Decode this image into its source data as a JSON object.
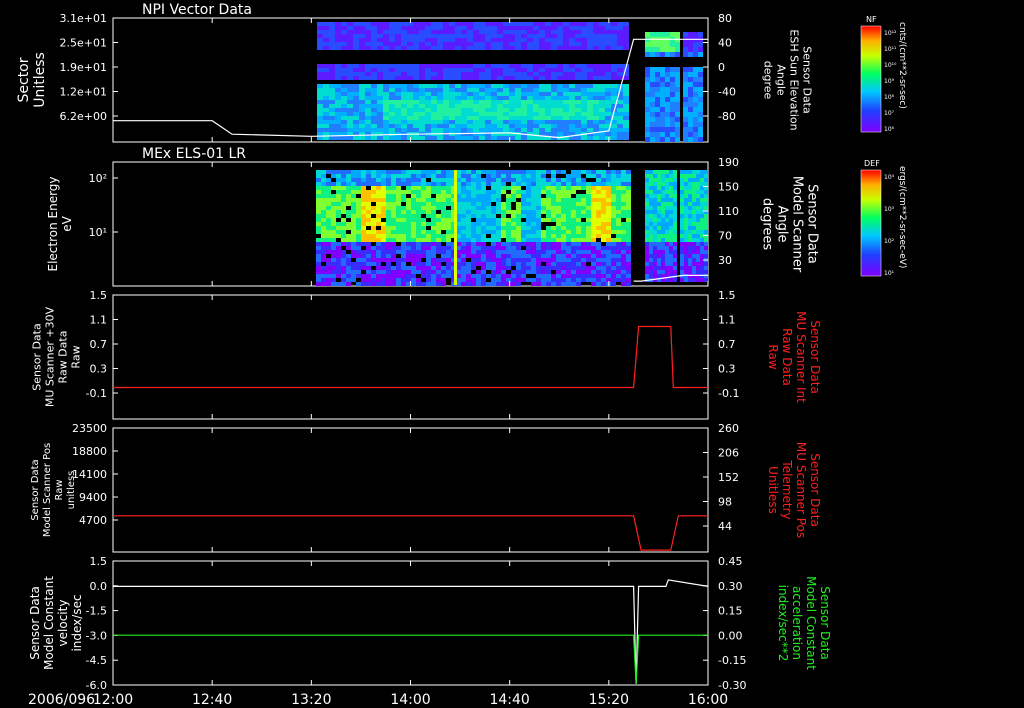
{
  "chart_data": [
    {
      "type": "heatmap",
      "title": "NPI Vector Data",
      "ylabel": [
        "Sector",
        "Unitless"
      ],
      "y_ticks": [
        "3.1e+01",
        "2.5e+01",
        "1.9e+01",
        "1.2e+01",
        "6.2e+00"
      ],
      "right_ylabel": [
        "Sensor Data",
        "ESH Sun Elevation",
        "Angle",
        "degree"
      ],
      "right_ticks": [
        "80",
        "40",
        "0",
        "-40",
        "-80"
      ],
      "right_ylim": [
        -100,
        80
      ],
      "colorbar": {
        "label": "NF",
        "unit": "cnts/(cm**2-sr-sec)",
        "ticks": [
          "10¹²",
          "10¹¹",
          "10¹⁰",
          "10⁹",
          "10⁸",
          "10⁷",
          "10⁶"
        ]
      },
      "series": [
        {
          "x": [
            "12:00",
            "12:40",
            "12:48",
            "13:20",
            "14:00",
            "14:40",
            "15:00",
            "15:20",
            "15:30",
            "15:40",
            "16:00"
          ],
          "y": [
            -70,
            -70,
            -90,
            -93,
            -90,
            -88,
            -95,
            -85,
            50,
            50,
            50
          ]
        }
      ]
    },
    {
      "type": "heatmap",
      "title": "MEx ELS-01 LR",
      "ylabel": [
        "Electron Energy",
        "eV"
      ],
      "y_ticks": [
        "10²",
        "10¹"
      ],
      "right_ylabel": [
        "Sensor Data",
        "Model Scanner",
        "Angle",
        "degrees"
      ],
      "right_ticks": [
        "190",
        "150",
        "110",
        "70",
        "30"
      ],
      "right_ylim": [
        0,
        190
      ],
      "colorbar": {
        "label": "DEF",
        "unit": "ergs/(cm**2-sr-sec-eV)",
        "ticks": [
          "10⁴",
          "10³",
          "10²",
          "10¹"
        ]
      },
      "series": [
        {
          "x": [
            "15:30",
            "15:33",
            "15:50",
            "16:00"
          ],
          "y": [
            6,
            6,
            15,
            15
          ]
        }
      ]
    },
    {
      "type": "line",
      "ylabel": [
        "Sensor Data",
        "MU Scanner +30V",
        "Raw Data",
        "Raw"
      ],
      "y_ticks": [
        "1.5",
        "1.1",
        "0.7",
        "0.3",
        "-0.1"
      ],
      "ylim": [
        -0.5,
        1.5
      ],
      "right_ylabel": [
        "Sensor Data",
        "MU Scanner Int",
        "Raw Data",
        "Raw"
      ],
      "right_ticks": [
        "1.5",
        "1.1",
        "0.7",
        "0.3",
        "-0.1"
      ],
      "series": [
        {
          "name": "Sensor Data MU Scanner Int Raw Data",
          "color": "#ff2020",
          "x": [
            "12:00",
            "15:30",
            "15:32",
            "15:45",
            "15:46",
            "16:00"
          ],
          "y": [
            0,
            0,
            1,
            1,
            0,
            0
          ]
        }
      ]
    },
    {
      "type": "line",
      "ylabel": [
        "Sensor Data",
        "Model Scanner Pos",
        "Raw",
        "unitless"
      ],
      "y_ticks": [
        "23500",
        "18800",
        "14100",
        "9400",
        "4700"
      ],
      "ylim": [
        0,
        23500
      ],
      "right_ylabel": [
        "Sensor Data",
        "MU Scanner Pos",
        "Telemetry",
        "Unitless"
      ],
      "right_ticks": [
        "260",
        "206",
        "152",
        "98",
        "44"
      ],
      "series": [
        {
          "name": "Sensor Data MU Scanner Pos Telemetry",
          "color": "#ff2020",
          "x": [
            "12:00",
            "15:30",
            "15:33",
            "15:45",
            "15:48",
            "16:00"
          ],
          "y": [
            75,
            75,
            2,
            2,
            75,
            75
          ]
        }
      ]
    },
    {
      "type": "line",
      "ylabel": [
        "Sensor Data",
        "Model Constant",
        "velocity",
        "index/sec"
      ],
      "y_ticks": [
        "1.5",
        "0.0",
        "-1.5",
        "-3.0",
        "-4.5",
        "-6.0"
      ],
      "ylim": [
        -6,
        1.5
      ],
      "right_ylabel": [
        "Sensor Data",
        "Model Constant",
        "acceleration",
        "index/sec**2"
      ],
      "right_ticks": [
        "0.45",
        "0.30",
        "0.15",
        "0.00",
        "-0.15",
        "-0.30"
      ],
      "x_ticks": [
        "12:00",
        "12:40",
        "13:20",
        "14:00",
        "14:40",
        "15:20",
        "16:00"
      ],
      "date_label": "2006/096",
      "series": [
        {
          "name": "Sensor Data Model Constant velocity",
          "color": "#ffffff",
          "x": [
            "12:00",
            "15:30",
            "15:31",
            "15:32",
            "15:43",
            "15:44",
            "16:00"
          ],
          "y": [
            0,
            0,
            -6,
            0,
            0,
            0.4,
            0
          ]
        },
        {
          "name": "Sensor Data Model Constant acceleration",
          "color": "#22ee22",
          "x": [
            "12:00",
            "15:30",
            "15:31",
            "15:32",
            "16:00"
          ],
          "y": [
            0,
            0,
            -0.3,
            0,
            0
          ]
        }
      ]
    }
  ]
}
